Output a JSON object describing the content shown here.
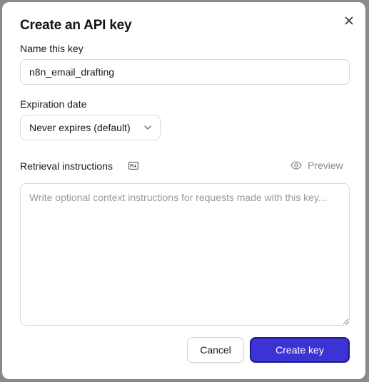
{
  "dialog": {
    "title": "Create an API key",
    "close_label": "×"
  },
  "name_field": {
    "label": "Name this key",
    "value": "n8n_email_drafting"
  },
  "expiration": {
    "label": "Expiration date",
    "selected": "Never expires (default)"
  },
  "instructions": {
    "label": "Retrieval instructions",
    "preview_label": "Preview",
    "placeholder": "Write optional context instructions for requests made with this key..."
  },
  "actions": {
    "cancel_label": "Cancel",
    "create_label": "Create key"
  },
  "colors": {
    "primary": "#3b33d4",
    "primary_border": "#1d1a8c",
    "border": "#dcdcdc",
    "muted_text": "#8a8a8a"
  },
  "icons": {
    "close": "close-icon",
    "chevron": "chevron-down-icon",
    "markdown": "markdown-icon",
    "preview": "eye-icon"
  }
}
